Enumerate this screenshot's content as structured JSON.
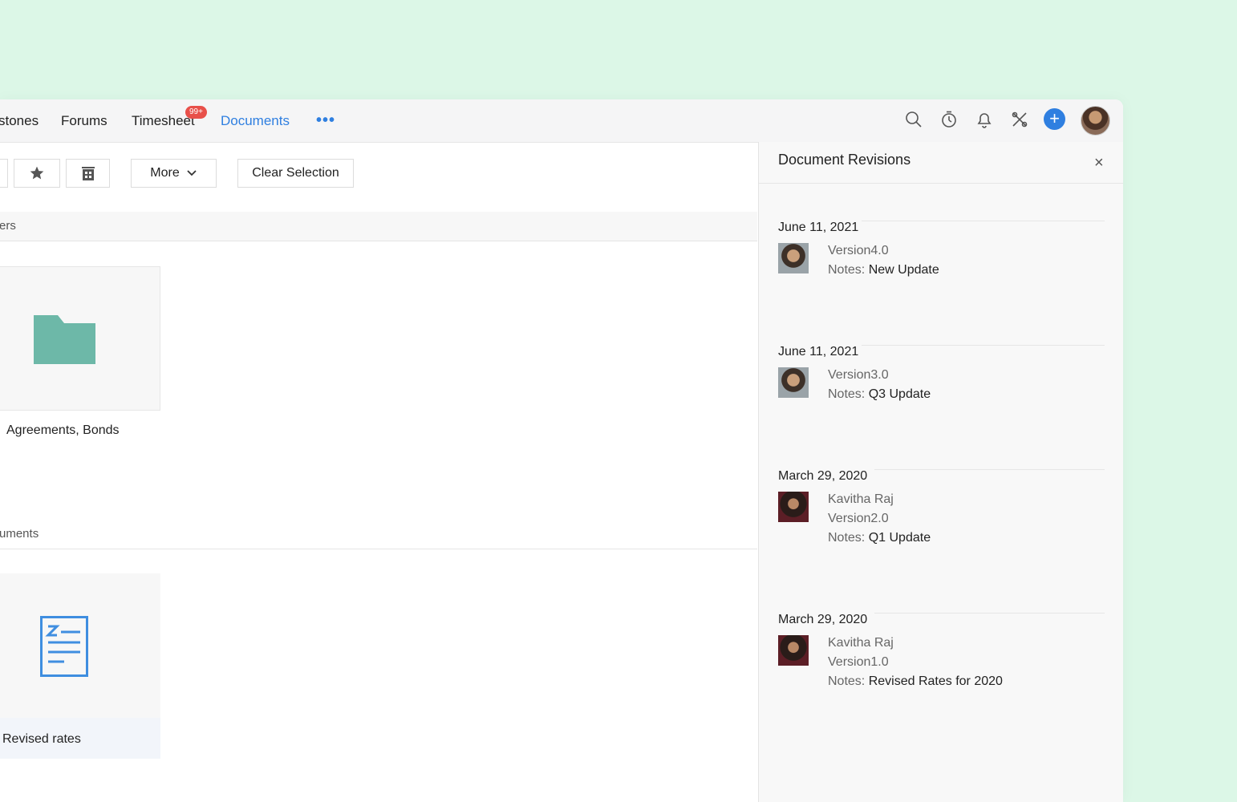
{
  "nav": {
    "items": [
      "stones",
      "Forums",
      "Timesheet",
      "Documents"
    ],
    "badge": "99+",
    "more": "•••"
  },
  "toolbar": {
    "more_label": "More",
    "clear_label": "Clear Selection"
  },
  "sections": {
    "folders_heading": "ers",
    "documents_heading": "uments"
  },
  "folder": {
    "label": "Agreements, Bonds"
  },
  "document": {
    "label": "Revised rates"
  },
  "panel": {
    "title": "Document Revisions",
    "close": "×",
    "notes_prefix": "Notes:",
    "revisions": [
      {
        "date": "June 11, 2021",
        "author": "",
        "version": "Version4.0",
        "notes": "New Update"
      },
      {
        "date": "June 11, 2021",
        "author": "",
        "version": "Version3.0",
        "notes": "Q3 Update"
      },
      {
        "date": "March 29, 2020",
        "author": "Kavitha Raj",
        "version": "Version2.0",
        "notes": "Q1 Update"
      },
      {
        "date": "March 29, 2020",
        "author": "Kavitha Raj",
        "version": "Version1.0",
        "notes": "Revised Rates for 2020"
      }
    ]
  },
  "colors": {
    "accent": "#2f7fe0",
    "badge": "#e8504a",
    "folder": "#6db8a8",
    "background": "#dcf7e7"
  }
}
